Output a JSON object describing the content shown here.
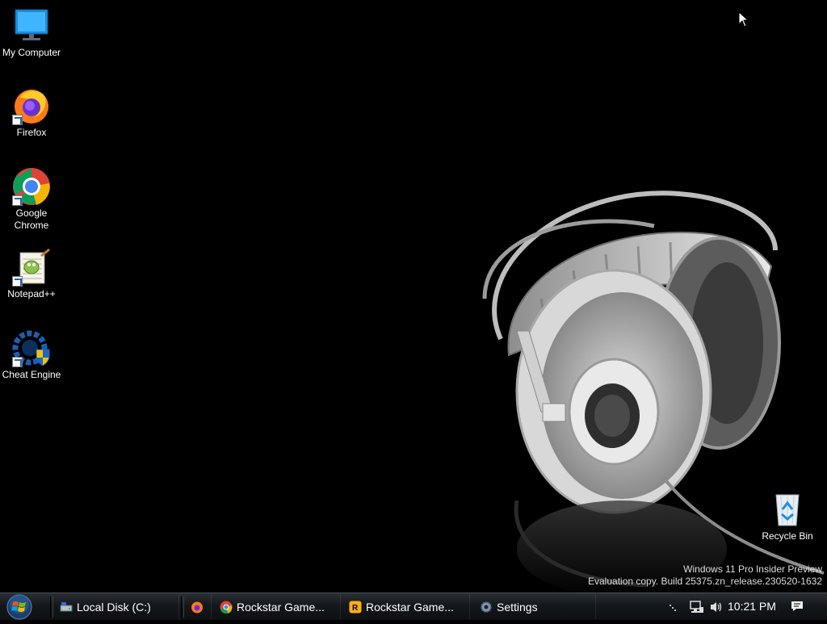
{
  "desktop": {
    "icons": [
      {
        "label": "My Computer"
      },
      {
        "label": "Firefox"
      },
      {
        "label": "Google Chrome"
      },
      {
        "label": "Notepad++"
      },
      {
        "label": "Cheat Engine"
      },
      {
        "label": "Recycle Bin"
      }
    ],
    "watermark": {
      "line1": "Windows 11 Pro Insider Preview",
      "line2": "Evaluation copy. Build 25375.zn_release.230520-1632"
    }
  },
  "taskbar": {
    "buttons": [
      {
        "label": "Local Disk (C:)"
      },
      {
        "label": "Rockstar Game..."
      },
      {
        "label": "Rockstar Game..."
      },
      {
        "label": "Settings"
      }
    ],
    "clock": "10:21 PM"
  },
  "colors": {
    "taskbar_top": "#2a2f35",
    "taskbar_bottom": "#0d0f11",
    "desktop_bg": "#000000",
    "firefox_orange": "#ff7a1a",
    "chrome_red": "#db4437",
    "chrome_green": "#0f9d58",
    "chrome_yellow": "#f4b400",
    "chrome_blue": "#4285f4",
    "rockstar_yellow": "#fcaf17"
  }
}
